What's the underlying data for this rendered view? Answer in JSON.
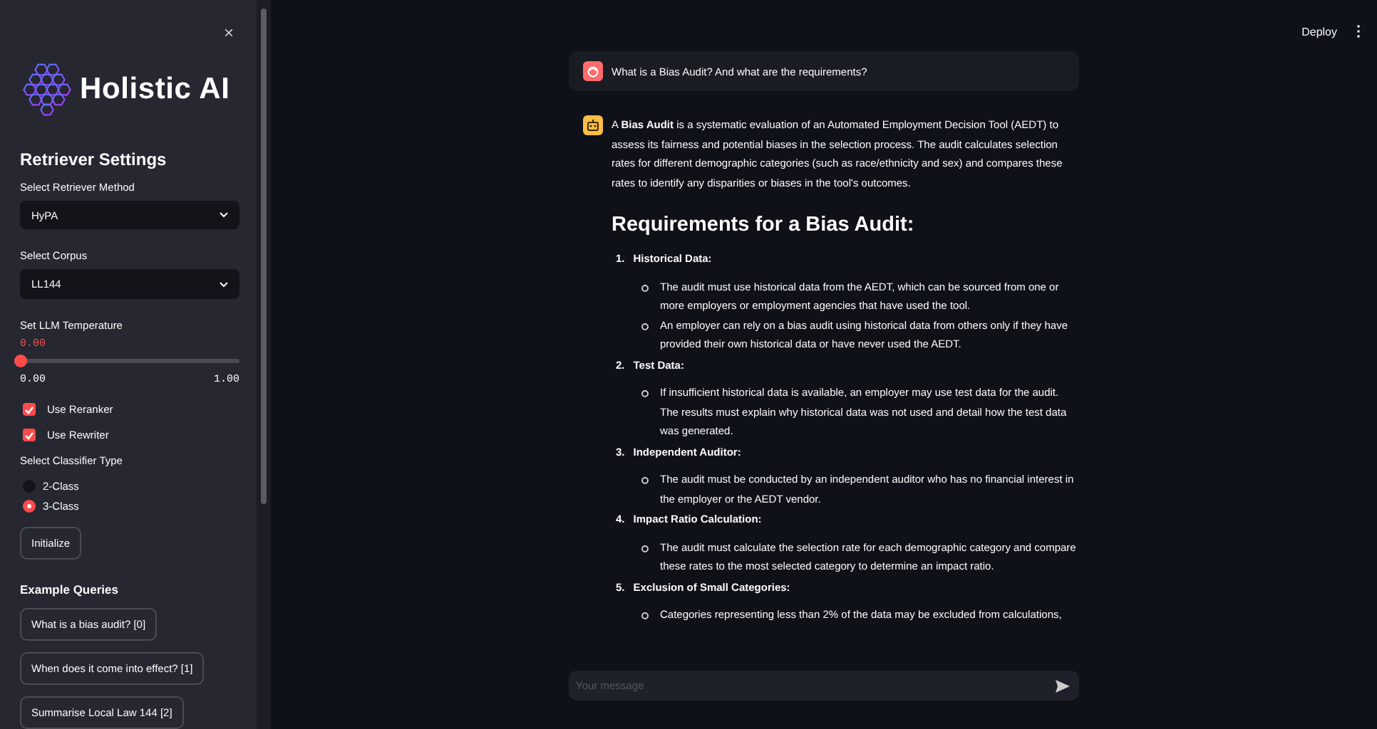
{
  "sidebar": {
    "close": "×",
    "brand": "Holistic AI",
    "section_title": "Retriever Settings",
    "controls": [
      {
        "kind": "select",
        "label": "Select Retriever Method",
        "value": "HyPA"
      },
      {
        "kind": "select",
        "label": "Select Corpus",
        "value": "LL144"
      },
      {
        "kind": "slider",
        "label": "Set LLM Temperature",
        "value": "0.00",
        "level": 0,
        "min": "0.00",
        "max": "1.00"
      },
      {
        "kind": "checkbox",
        "label": "Use Reranker",
        "checked": true
      },
      {
        "kind": "checkbox",
        "label": "Use Rewriter",
        "checked": true
      },
      {
        "kind": "radio",
        "label": "Select Classifier Type",
        "options": [
          {
            "label": "2-Class",
            "selected": false
          },
          {
            "label": "3-Class",
            "selected": true
          }
        ]
      },
      {
        "kind": "button",
        "label": "Initialize"
      }
    ],
    "example_queries": {
      "title": "Example Queries",
      "buttons": [
        "What is a bias audit? [0]",
        "When does it come into effect? [1]",
        "Summarise Local Law 144 [2]"
      ]
    }
  },
  "header": {
    "deploy": "Deploy",
    "menu": "⋮"
  },
  "chat": {
    "messages": [
      {
        "kind": "user",
        "text": "What is a Bias Audit? And what are the requirements?"
      },
      {
        "kind": "assistant",
        "intro": "A **Bias Audit** is a systematic evaluation of an Automated Employment Decision Tool (AEDT) to assess its fairness and potential biases in the selection process. The audit calculates selection rates for different demographic categories (such as race/ethnicity and sex) and compares these rates to identify any disparities or biases in the tool's outcomes.",
        "heading": "Requirements for a Bias Audit:",
        "items": [
          {
            "number": "1.",
            "title": "Historical Data:",
            "points": [
              "The audit must use historical data from the AEDT, which can be sourced from one or more employers or employment agencies that have used the tool.",
              "An employer can rely on a bias audit using historical data from others only if they have provided their own historical data or have never used the AEDT."
            ]
          },
          {
            "number": "2.",
            "title": "Test Data:",
            "points": [
              "If insufficient historical data is available, an employer may use test data for the audit. The results must explain why historical data was not used and detail how the test data was generated."
            ]
          },
          {
            "number": "3.",
            "title": "Independent Auditor:",
            "points": [
              "The audit must be conducted by an independent auditor who has no financial interest in the employer or the AEDT vendor."
            ]
          },
          {
            "number": "4.",
            "title": "Impact Ratio Calculation:",
            "points": [
              "The audit must calculate the selection rate for each demographic category and compare these rates to the most selected category to determine an impact ratio."
            ]
          },
          {
            "number": "5.",
            "title": "Exclusion of Small Categories:",
            "points": [
              "Categories representing less than 2% of the data may be excluded from calculations,"
            ]
          }
        ]
      }
    ]
  },
  "input": {
    "placeholder": "Your message"
  }
}
